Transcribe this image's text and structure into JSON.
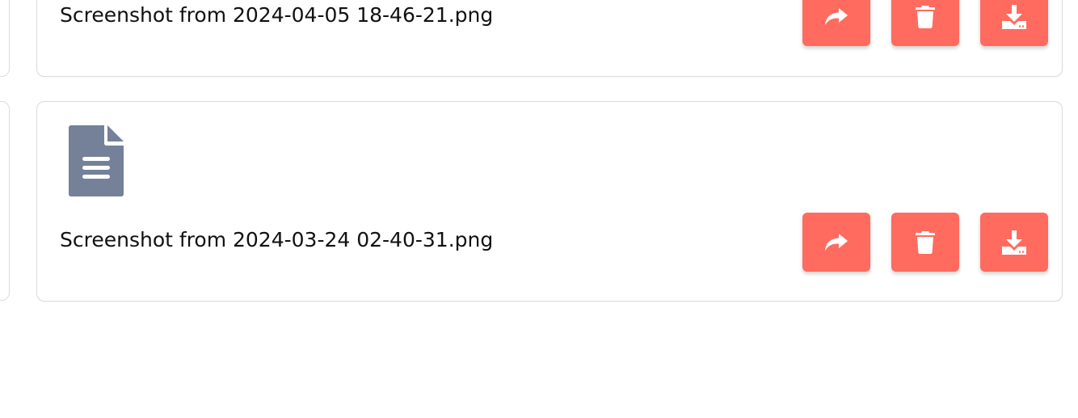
{
  "colors": {
    "accent": "#ff6b5f",
    "file_icon": "#748199",
    "card_border": "#dcdcdc"
  },
  "files": [
    {
      "name": "Screenshot from 2024-04-05 18-46-21.png",
      "icon": "file-text-icon",
      "actions": [
        "share-icon",
        "trash-icon",
        "download-icon"
      ]
    },
    {
      "name": "Screenshot from 2024-03-24 02-40-31.png",
      "icon": "file-text-icon",
      "actions": [
        "share-icon",
        "trash-icon",
        "download-icon"
      ]
    }
  ]
}
